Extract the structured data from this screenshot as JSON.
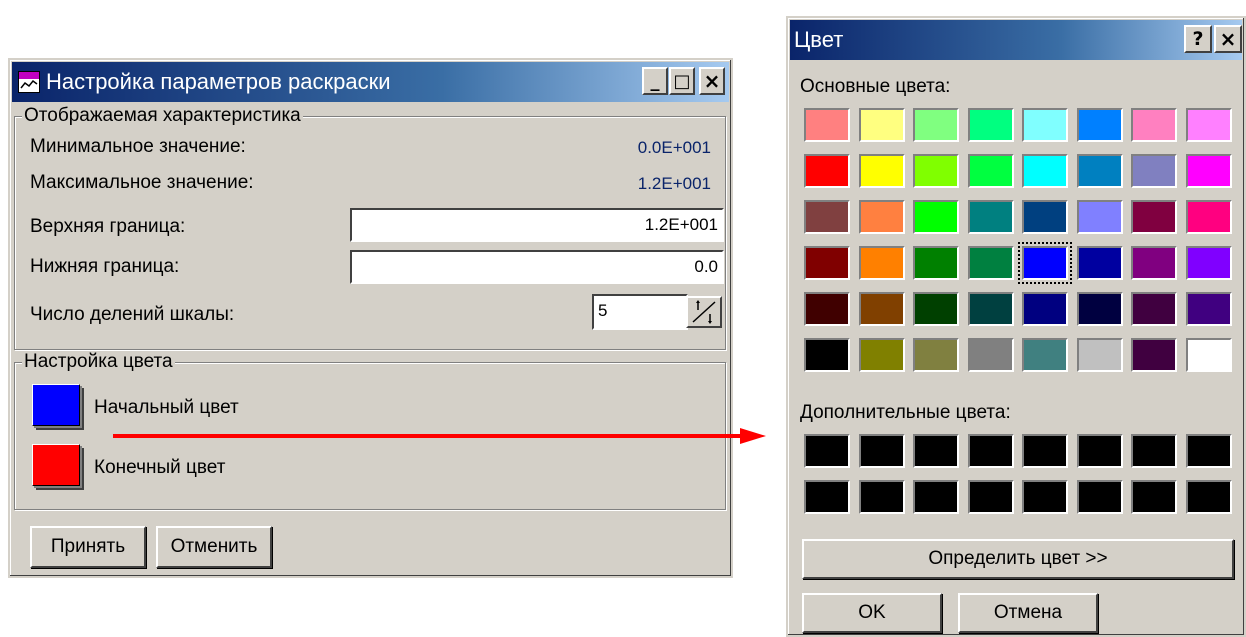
{
  "settings_window": {
    "title": "Настройка параметров раскраски",
    "group_characteristic": {
      "legend": "Отображаемая характеристика",
      "min_label": "Минимальное значение:",
      "min_value": "0.0E+001",
      "max_label": "Максимальное значение:",
      "max_value": "1.2E+001",
      "upper_label": "Верхняя граница:",
      "upper_value": "1.2E+001",
      "lower_label": "Нижняя граница:",
      "lower_value": "0.0",
      "divisions_label": "Число делений шкалы:",
      "divisions_value": "5"
    },
    "group_color": {
      "legend": "Настройка цвета",
      "start_label": "Начальный цвет",
      "start_color": "#0000ff",
      "end_label": "Конечный цвет",
      "end_color": "#ff0000"
    },
    "accept_button": "Принять",
    "cancel_button": "Отменить",
    "controls": [
      "_",
      "□",
      "×"
    ]
  },
  "color_dialog": {
    "title": "Цвет",
    "help_button": "?",
    "close_button": "×",
    "basic_colors_label": "Основные цвета:",
    "basic_colors": [
      [
        "#ff8080",
        "#ffff80",
        "#80ff80",
        "#00ff80",
        "#80ffff",
        "#0080ff",
        "#ff80c0",
        "#ff80ff"
      ],
      [
        "#ff0000",
        "#ffff00",
        "#80ff00",
        "#00ff40",
        "#00ffff",
        "#0080c0",
        "#8080c0",
        "#ff00ff"
      ],
      [
        "#804040",
        "#ff8040",
        "#00ff00",
        "#008080",
        "#004080",
        "#8080ff",
        "#800040",
        "#ff0080"
      ],
      [
        "#800000",
        "#ff8000",
        "#008000",
        "#008040",
        "#0000ff",
        "#0000a0",
        "#800080",
        "#8000ff"
      ],
      [
        "#400000",
        "#804000",
        "#004000",
        "#004040",
        "#000080",
        "#000040",
        "#400040",
        "#400080"
      ],
      [
        "#000000",
        "#808000",
        "#808040",
        "#808080",
        "#408080",
        "#c0c0c0",
        "#400040",
        "#ffffff"
      ]
    ],
    "selected_color": "#0000ff",
    "custom_colors_label": "Дополнительные цвета:",
    "custom_colors": [
      [
        "#000000",
        "#000000",
        "#000000",
        "#000000",
        "#000000",
        "#000000",
        "#000000",
        "#000000"
      ],
      [
        "#000000",
        "#000000",
        "#000000",
        "#000000",
        "#000000",
        "#000000",
        "#000000",
        "#000000"
      ]
    ],
    "define_button": "Определить цвет >>",
    "ok_button": "OK",
    "cancel_button": "Отмена"
  },
  "arrow_color": "#ff0000"
}
